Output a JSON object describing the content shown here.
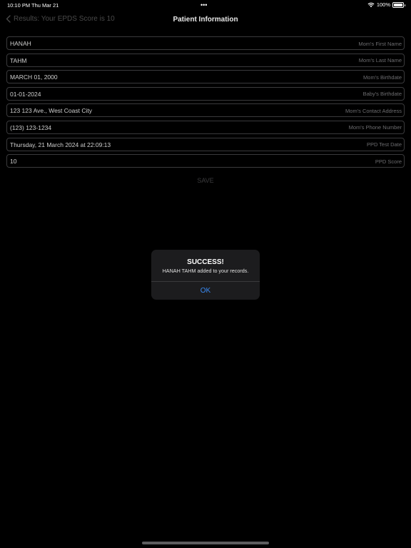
{
  "status_bar": {
    "time": "10:10 PM",
    "date": "Thu Mar 21",
    "battery": "100%",
    "battery_level": 1.0
  },
  "nav": {
    "back_label": "Results: Your EPDS Score is 10",
    "title": "Patient Information"
  },
  "form": {
    "fields": [
      {
        "value": "HANAH",
        "placeholder": "Mom's First Name"
      },
      {
        "value": "TAHM",
        "placeholder": "Mom's Last Name"
      },
      {
        "value": "MARCH 01, 2000",
        "placeholder": "Mom's Birthdate"
      },
      {
        "value": "01-01-2024",
        "placeholder": "Baby's Birthdate"
      },
      {
        "value": "123 123 Ave., West Coast City",
        "placeholder": "Mom's Contact Address"
      },
      {
        "value": "(123) 123-1234",
        "placeholder": "Mom's Phone Number"
      },
      {
        "value": "Thursday, 21 March 2024 at 22:09:13",
        "placeholder": "PPD Test Date"
      },
      {
        "value": "10",
        "placeholder": "PPD Score"
      }
    ],
    "save_label": "SAVE"
  },
  "alert": {
    "title": "SUCCESS!",
    "message": "HANAH TAHM added to your records.",
    "ok_label": "OK"
  },
  "colors": {
    "background": "#000000",
    "accent": "#3a8bf5"
  }
}
